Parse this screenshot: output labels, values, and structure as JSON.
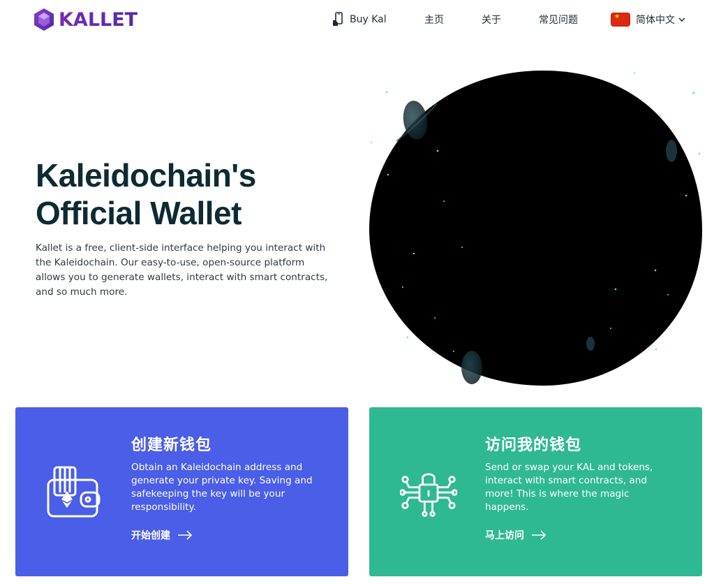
{
  "header": {
    "logo_text": "KALLET",
    "nav": {
      "buy_label": "Buy Kal",
      "home_label": "主页",
      "about_label": "关于",
      "faq_label": "常见问题",
      "language_label": "简体中文"
    },
    "icons": {
      "buy": "phone-hand-icon",
      "language_flag": "china-flag-icon",
      "language_dropdown": "chevron-down-icon"
    }
  },
  "hero": {
    "title_line1": "Kaleidochain's",
    "title_line2": "Official Wallet",
    "description": "Kallet is a free, client-side interface helping you interact with the Kaleidochain. Our easy-to-use, open-source platform allows you to generate wallets, interact with smart contracts, and so much more."
  },
  "cards": {
    "create": {
      "title": "创建新钱包",
      "description": "Obtain an Kaleidochain address and generate your private key. Saving and safekeeping the key will be your responsibility.",
      "link_label": "开始创建",
      "icon": "wallet-icon",
      "color": "#4a5ee8"
    },
    "access": {
      "title": "访问我的钱包",
      "description": "Send or swap your KAL and tokens, interact with smart contracts, and more! This is where the magic happens.",
      "link_label": "马上访问",
      "icon": "circuit-lock-icon",
      "color": "#2fb993"
    }
  },
  "colors": {
    "brand": "#6a2ab6",
    "heading": "#0e2a33"
  }
}
